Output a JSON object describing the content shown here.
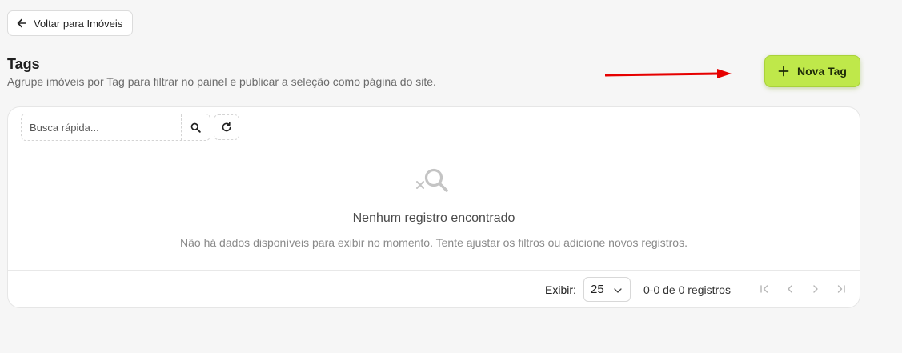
{
  "header": {
    "back_label": "Voltar para Imóveis",
    "title": "Tags",
    "subtitle": "Agrupe imóveis por Tag para filtrar no painel e publicar a seleção como página do site.",
    "new_button_label": "Nova Tag"
  },
  "toolbar": {
    "search_placeholder": "Busca rápida..."
  },
  "empty_state": {
    "title": "Nenhum registro encontrado",
    "description": "Não há dados disponíveis para exibir no momento. Tente ajustar os filtros ou adicione novos registros."
  },
  "footer": {
    "show_label": "Exibir:",
    "per_page": "25",
    "range": "0-0 de 0 registros"
  },
  "colors": {
    "accent": "#bfe84a",
    "annotation_arrow": "#e60000"
  }
}
